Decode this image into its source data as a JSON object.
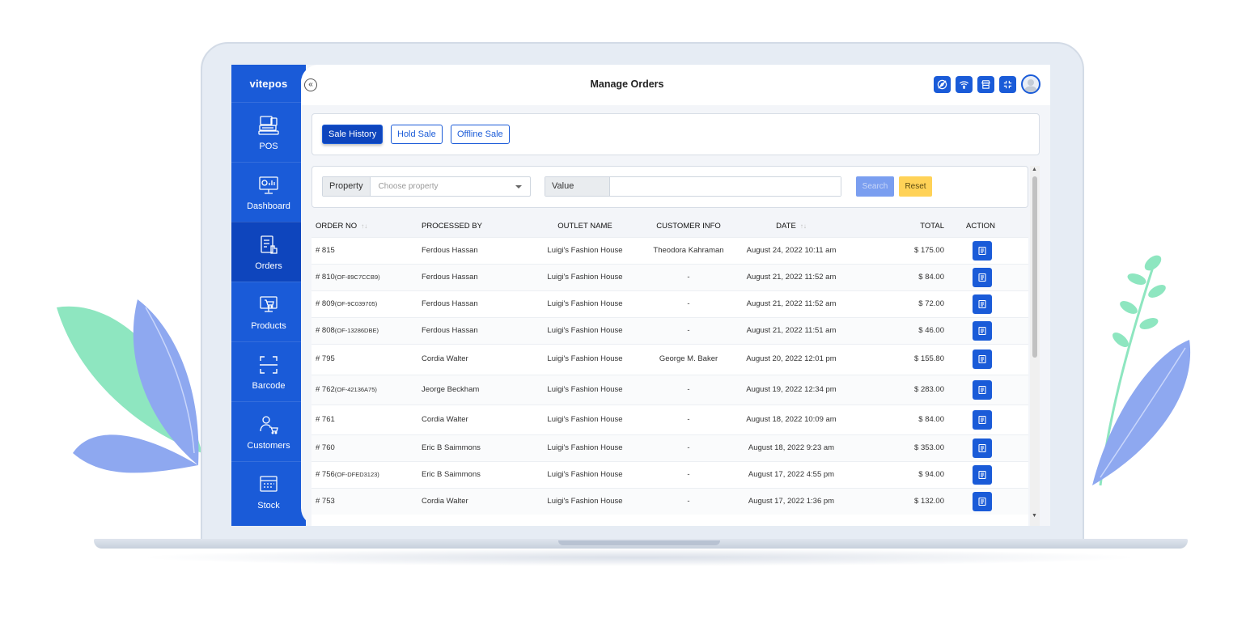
{
  "brand": "vitepos",
  "page_title": "Manage Orders",
  "sidebar": {
    "items": [
      {
        "label": "POS",
        "icon": "pos-terminal-icon",
        "active": false
      },
      {
        "label": "Dashboard",
        "icon": "dashboard-icon",
        "active": false
      },
      {
        "label": "Orders",
        "icon": "orders-icon",
        "active": true
      },
      {
        "label": "Products",
        "icon": "products-icon",
        "active": false
      },
      {
        "label": "Barcode",
        "icon": "barcode-icon",
        "active": false
      },
      {
        "label": "Customers",
        "icon": "customers-icon",
        "active": false
      },
      {
        "label": "Stock",
        "icon": "stock-icon",
        "active": false
      }
    ]
  },
  "header_icons": [
    "compass-icon",
    "wifi-icon",
    "store-icon",
    "compress-icon",
    "avatar"
  ],
  "tabs": [
    {
      "label": "Sale History",
      "active": true
    },
    {
      "label": "Hold Sale",
      "active": false
    },
    {
      "label": "Offline Sale",
      "active": false
    }
  ],
  "filter": {
    "property_label": "Property",
    "property_placeholder": "Choose property",
    "value_label": "Value",
    "value_text": "",
    "search_label": "Search",
    "reset_label": "Reset"
  },
  "table": {
    "columns": [
      "ORDER NO",
      "PROCESSED BY",
      "OUTLET NAME",
      "CUSTOMER INFO",
      "DATE",
      "TOTAL",
      "ACTION"
    ],
    "rows": [
      {
        "order_no": "# 815",
        "suffix": "",
        "processed_by": "Ferdous Hassan",
        "outlet": "Luigi's Fashion House",
        "customer": "Theodora Kahraman",
        "date": "August 24, 2022 10:11 am",
        "total": "$ 175.00"
      },
      {
        "order_no": "# 810",
        "suffix": "(OF-89C7CCB9)",
        "processed_by": "Ferdous Hassan",
        "outlet": "Luigi's Fashion House",
        "customer": "-",
        "date": "August 21, 2022 11:52 am",
        "total": "$ 84.00"
      },
      {
        "order_no": "# 809",
        "suffix": "(OF-9C039705)",
        "processed_by": "Ferdous Hassan",
        "outlet": "Luigi's Fashion House",
        "customer": "-",
        "date": "August 21, 2022 11:52 am",
        "total": "$ 72.00"
      },
      {
        "order_no": "# 808",
        "suffix": "(OF-13286DBE)",
        "processed_by": "Ferdous Hassan",
        "outlet": "Luigi's Fashion House",
        "customer": "-",
        "date": "August 21, 2022 11:51 am",
        "total": "$ 46.00"
      },
      {
        "order_no": "# 795",
        "suffix": "",
        "processed_by": "Cordia Walter",
        "outlet": "Luigi's Fashion House",
        "customer": "George M. Baker",
        "date": "August 20, 2022 12:01 pm",
        "total": "$ 155.80"
      },
      {
        "order_no": "# 762",
        "suffix": "(OF-42136A75)",
        "processed_by": "Jeorge Beckham",
        "outlet": "Luigi's Fashion House",
        "customer": "-",
        "date": "August 19, 2022 12:34 pm",
        "total": "$ 283.00"
      },
      {
        "order_no": "# 761",
        "suffix": "",
        "processed_by": "Cordia Walter",
        "outlet": "Luigi's Fashion House",
        "customer": "-",
        "date": "August 18, 2022 10:09 am",
        "total": "$ 84.00"
      },
      {
        "order_no": "# 760",
        "suffix": "",
        "processed_by": "Eric B Saimmons",
        "outlet": "Luigi's Fashion House",
        "customer": "-",
        "date": "August 18, 2022 9:23 am",
        "total": "$ 353.00"
      },
      {
        "order_no": "# 756",
        "suffix": "(OF-DFED3123)",
        "processed_by": "Eric B Saimmons",
        "outlet": "Luigi's Fashion House",
        "customer": "-",
        "date": "August 17, 2022 4:55 pm",
        "total": "$ 94.00"
      },
      {
        "order_no": "# 753",
        "suffix": "",
        "processed_by": "Cordia Walter",
        "outlet": "Luigi's Fashion House",
        "customer": "-",
        "date": "August 17, 2022 1:36 pm",
        "total": "$ 132.00"
      }
    ]
  },
  "colors": {
    "primary": "#1a5bd8",
    "sidebar_active": "#0e45bd",
    "reset_yellow": "#ffd257",
    "plant_green": "#8ee6c0",
    "plant_blue": "#8ea8f0"
  }
}
